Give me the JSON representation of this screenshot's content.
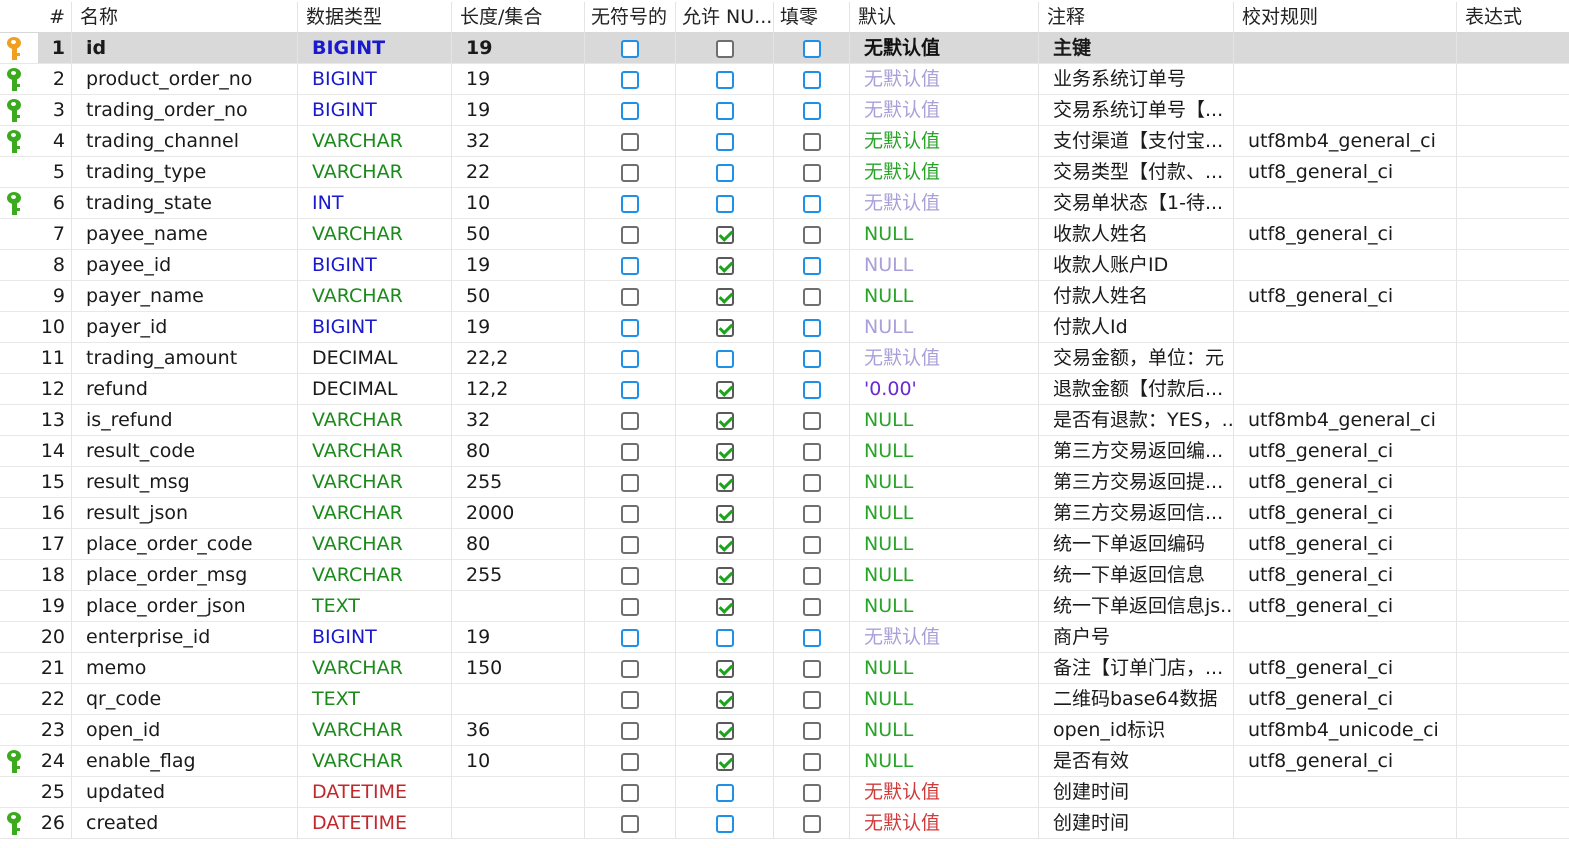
{
  "headers": {
    "num": "#",
    "name": "名称",
    "type": "数据类型",
    "len": "长度/集合",
    "uns": "无符号的",
    "null": "允许 NU...",
    "zero": "填零",
    "def": "默认",
    "cmt": "注释",
    "col": "校对规则",
    "expr": "表达式"
  },
  "rows": [
    {
      "n": "1",
      "name": "id",
      "type": "BIGINT",
      "tc": "blue",
      "len": "19",
      "uns": "blue",
      "nul": "gray",
      "zero": "blue",
      "def": "无默认值",
      "dc": "black",
      "cmt": "主键",
      "col": "",
      "key": "gold",
      "sel": true
    },
    {
      "n": "2",
      "name": "product_order_no",
      "type": "BIGINT",
      "tc": "blue",
      "len": "19",
      "uns": "blue",
      "nul": "blue",
      "zero": "blue",
      "def": "无默认值",
      "dc": "lav",
      "cmt": "业务系统订单号",
      "col": "",
      "key": "green"
    },
    {
      "n": "3",
      "name": "trading_order_no",
      "type": "BIGINT",
      "tc": "blue",
      "len": "19",
      "uns": "blue",
      "nul": "blue",
      "zero": "blue",
      "def": "无默认值",
      "dc": "lav",
      "cmt": "交易系统订单号【...",
      "col": "",
      "key": "green"
    },
    {
      "n": "4",
      "name": "trading_channel",
      "type": "VARCHAR",
      "tc": "green",
      "len": "32",
      "uns": "gray",
      "nul": "blue",
      "zero": "gray",
      "def": "无默认值",
      "dc": "green",
      "cmt": "支付渠道【支付宝...",
      "col": "utf8mb4_general_ci",
      "key": "green"
    },
    {
      "n": "5",
      "name": "trading_type",
      "type": "VARCHAR",
      "tc": "green",
      "len": "22",
      "uns": "gray",
      "nul": "blue",
      "zero": "gray",
      "def": "无默认值",
      "dc": "green",
      "cmt": "交易类型【付款、...",
      "col": "utf8_general_ci",
      "key": ""
    },
    {
      "n": "6",
      "name": "trading_state",
      "type": "INT",
      "tc": "blue",
      "len": "10",
      "uns": "blue",
      "nul": "blue",
      "zero": "blue",
      "def": "无默认值",
      "dc": "lav",
      "cmt": "交易单状态【1-待...",
      "col": "",
      "key": "green"
    },
    {
      "n": "7",
      "name": "payee_name",
      "type": "VARCHAR",
      "tc": "green",
      "len": "50",
      "uns": "gray",
      "nul": "checked",
      "zero": "gray",
      "def": "NULL",
      "dc": "green",
      "cmt": "收款人姓名",
      "col": "utf8_general_ci",
      "key": ""
    },
    {
      "n": "8",
      "name": "payee_id",
      "type": "BIGINT",
      "tc": "blue",
      "len": "19",
      "uns": "blue",
      "nul": "checked",
      "zero": "blue",
      "def": "NULL",
      "dc": "lav",
      "cmt": "收款人账户ID",
      "col": "",
      "key": ""
    },
    {
      "n": "9",
      "name": "payer_name",
      "type": "VARCHAR",
      "tc": "green",
      "len": "50",
      "uns": "gray",
      "nul": "checked",
      "zero": "gray",
      "def": "NULL",
      "dc": "green",
      "cmt": "付款人姓名",
      "col": "utf8_general_ci",
      "key": ""
    },
    {
      "n": "10",
      "name": "payer_id",
      "type": "BIGINT",
      "tc": "blue",
      "len": "19",
      "uns": "blue",
      "nul": "checked",
      "zero": "blue",
      "def": "NULL",
      "dc": "lav",
      "cmt": "付款人Id",
      "col": "",
      "key": ""
    },
    {
      "n": "11",
      "name": "trading_amount",
      "type": "DECIMAL",
      "tc": "purple",
      "len": "22,2",
      "uns": "blue",
      "nul": "blue",
      "zero": "blue",
      "def": "无默认值",
      "dc": "lav",
      "cmt": "交易金额，单位：元",
      "col": "",
      "key": ""
    },
    {
      "n": "12",
      "name": "refund",
      "type": "DECIMAL",
      "tc": "purple",
      "len": "12,2",
      "uns": "blue",
      "nul": "checked",
      "zero": "blue",
      "def": "'0.00'",
      "dc": "purple",
      "cmt": "退款金额【付款后...",
      "col": "",
      "key": ""
    },
    {
      "n": "13",
      "name": "is_refund",
      "type": "VARCHAR",
      "tc": "green",
      "len": "32",
      "uns": "gray",
      "nul": "checked",
      "zero": "gray",
      "def": "NULL",
      "dc": "green",
      "cmt": "是否有退款：YES，...",
      "col": "utf8mb4_general_ci",
      "key": ""
    },
    {
      "n": "14",
      "name": "result_code",
      "type": "VARCHAR",
      "tc": "green",
      "len": "80",
      "uns": "gray",
      "nul": "checked",
      "zero": "gray",
      "def": "NULL",
      "dc": "green",
      "cmt": "第三方交易返回编...",
      "col": "utf8_general_ci",
      "key": ""
    },
    {
      "n": "15",
      "name": "result_msg",
      "type": "VARCHAR",
      "tc": "green",
      "len": "255",
      "uns": "gray",
      "nul": "checked",
      "zero": "gray",
      "def": "NULL",
      "dc": "green",
      "cmt": "第三方交易返回提...",
      "col": "utf8_general_ci",
      "key": ""
    },
    {
      "n": "16",
      "name": "result_json",
      "type": "VARCHAR",
      "tc": "green",
      "len": "2000",
      "uns": "gray",
      "nul": "checked",
      "zero": "gray",
      "def": "NULL",
      "dc": "green",
      "cmt": "第三方交易返回信...",
      "col": "utf8_general_ci",
      "key": ""
    },
    {
      "n": "17",
      "name": "place_order_code",
      "type": "VARCHAR",
      "tc": "green",
      "len": "80",
      "uns": "gray",
      "nul": "checked",
      "zero": "gray",
      "def": "NULL",
      "dc": "green",
      "cmt": "统一下单返回编码",
      "col": "utf8_general_ci",
      "key": ""
    },
    {
      "n": "18",
      "name": "place_order_msg",
      "type": "VARCHAR",
      "tc": "green",
      "len": "255",
      "uns": "gray",
      "nul": "checked",
      "zero": "gray",
      "def": "NULL",
      "dc": "green",
      "cmt": "统一下单返回信息",
      "col": "utf8_general_ci",
      "key": ""
    },
    {
      "n": "19",
      "name": "place_order_json",
      "type": "TEXT",
      "tc": "green",
      "len": "",
      "uns": "gray",
      "nul": "checked",
      "zero": "gray",
      "def": "NULL",
      "dc": "green",
      "cmt": "统一下单返回信息js...",
      "col": "utf8_general_ci",
      "key": ""
    },
    {
      "n": "20",
      "name": "enterprise_id",
      "type": "BIGINT",
      "tc": "blue",
      "len": "19",
      "uns": "blue",
      "nul": "blue",
      "zero": "blue",
      "def": "无默认值",
      "dc": "lav",
      "cmt": "商户号",
      "col": "",
      "key": ""
    },
    {
      "n": "21",
      "name": "memo",
      "type": "VARCHAR",
      "tc": "green",
      "len": "150",
      "uns": "gray",
      "nul": "checked",
      "zero": "gray",
      "def": "NULL",
      "dc": "green",
      "cmt": "备注【订单门店，...",
      "col": "utf8_general_ci",
      "key": ""
    },
    {
      "n": "22",
      "name": "qr_code",
      "type": "TEXT",
      "tc": "green",
      "len": "",
      "uns": "gray",
      "nul": "checked",
      "zero": "gray",
      "def": "NULL",
      "dc": "green",
      "cmt": "二维码base64数据",
      "col": "utf8_general_ci",
      "key": ""
    },
    {
      "n": "23",
      "name": "open_id",
      "type": "VARCHAR",
      "tc": "green",
      "len": "36",
      "uns": "gray",
      "nul": "checked",
      "zero": "gray",
      "def": "NULL",
      "dc": "green",
      "cmt": "open_id标识",
      "col": "utf8mb4_unicode_ci",
      "key": ""
    },
    {
      "n": "24",
      "name": "enable_flag",
      "type": "VARCHAR",
      "tc": "green",
      "len": "10",
      "uns": "gray",
      "nul": "checked",
      "zero": "gray",
      "def": "NULL",
      "dc": "green",
      "cmt": "是否有效",
      "col": "utf8_general_ci",
      "key": "green"
    },
    {
      "n": "25",
      "name": "updated",
      "type": "DATETIME",
      "tc": "red",
      "len": "",
      "uns": "gray",
      "nul": "blue",
      "zero": "gray",
      "def": "无默认值",
      "dc": "red",
      "cmt": "创建时间",
      "col": "",
      "key": ""
    },
    {
      "n": "26",
      "name": "created",
      "type": "DATETIME",
      "tc": "red",
      "len": "",
      "uns": "gray",
      "nul": "blue",
      "zero": "gray",
      "def": "无默认值",
      "dc": "red",
      "cmt": "创建时间",
      "col": "",
      "key": "green"
    }
  ]
}
